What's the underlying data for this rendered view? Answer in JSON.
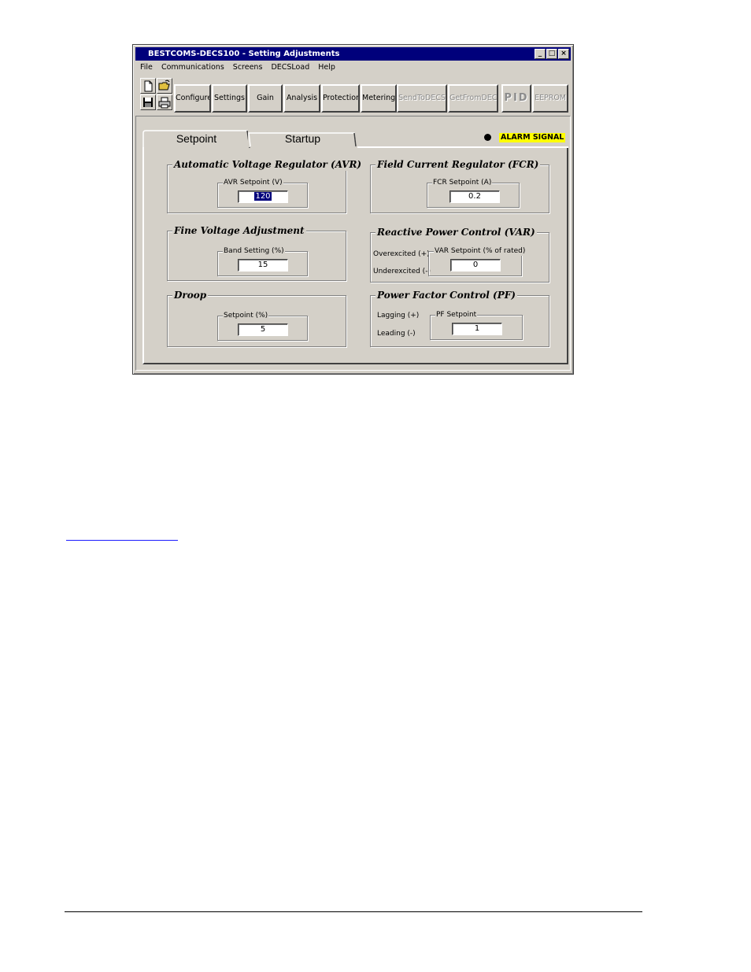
{
  "window": {
    "title": "BESTCOMS-DECS100 - Setting Adjustments",
    "controls": {
      "minimize": "_",
      "maximize": "□",
      "close": "×"
    }
  },
  "menu": [
    "File",
    "Communications",
    "Screens",
    "DECSLoad",
    "Help"
  ],
  "toolbar": {
    "icons": [
      "new-file-icon",
      "open-folder-icon",
      "save-disk-icon",
      "print-icon"
    ],
    "buttons": [
      {
        "label": "Configure",
        "enabled": true
      },
      {
        "label": "Settings",
        "enabled": true
      },
      {
        "label": "Gain",
        "enabled": true
      },
      {
        "label": "Analysis",
        "enabled": true
      },
      {
        "label": "Protection",
        "enabled": true
      },
      {
        "label": "Metering",
        "enabled": true
      },
      {
        "label": "SendToDECS",
        "enabled": false
      },
      {
        "label": "GetFromDECS",
        "enabled": false
      },
      {
        "label": "PID",
        "enabled": false
      },
      {
        "label": "EEPROM",
        "enabled": false
      }
    ]
  },
  "tabs": [
    {
      "label": "Setpoint",
      "active": true
    },
    {
      "label": "Startup",
      "active": false
    }
  ],
  "alarm": {
    "label": "ALARM SIGNAL",
    "color": "#ffff00"
  },
  "groups": {
    "avr": {
      "title": "Automatic Voltage Regulator (AVR)",
      "field_label": "AVR Setpoint (V)",
      "value": "120"
    },
    "fcr": {
      "title": "Field Current Regulator (FCR)",
      "field_label": "FCR Setpoint (A)",
      "value": "0.2"
    },
    "fine": {
      "title": "Fine Voltage Adjustment",
      "field_label": "Band Setting (%)",
      "value": "15"
    },
    "var": {
      "title": "Reactive Power Control (VAR)",
      "field_label": "VAR Setpoint (% of rated)",
      "value": "0",
      "label_over": "Overexcited (+)",
      "label_under": "Underexcited (-)"
    },
    "droop": {
      "title": "Droop",
      "field_label": "Setpoint (%)",
      "value": "5"
    },
    "pf": {
      "title": "Power Factor Control (PF)",
      "field_label": "PF Setpoint",
      "value": "1",
      "label_lag": "Lagging (+)",
      "label_lead": "Leading (-)"
    }
  }
}
